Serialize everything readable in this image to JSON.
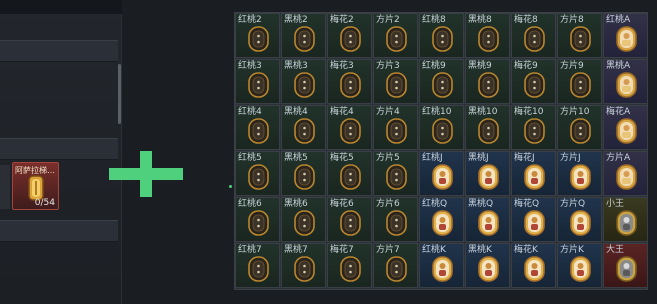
{
  "item": {
    "name": "阿萨拉梯…",
    "count": "0/54"
  },
  "columns": [
    "红桃",
    "黑桃",
    "梅花",
    "方片",
    "红桃",
    "黑桃",
    "梅花",
    "方片",
    "红桃"
  ],
  "grid": [
    [
      {
        "label": "红桃2",
        "kind": "num"
      },
      {
        "label": "黑桃2",
        "kind": "num"
      },
      {
        "label": "梅花2",
        "kind": "num"
      },
      {
        "label": "方片2",
        "kind": "num"
      },
      {
        "label": "红桃8",
        "kind": "num"
      },
      {
        "label": "黑桃8",
        "kind": "num"
      },
      {
        "label": "梅花8",
        "kind": "num"
      },
      {
        "label": "方片8",
        "kind": "num"
      },
      {
        "label": "红桃A",
        "kind": "ace"
      }
    ],
    [
      {
        "label": "红桃3",
        "kind": "num"
      },
      {
        "label": "黑桃3",
        "kind": "num"
      },
      {
        "label": "梅花3",
        "kind": "num"
      },
      {
        "label": "方片3",
        "kind": "num"
      },
      {
        "label": "红桃9",
        "kind": "num"
      },
      {
        "label": "黑桃9",
        "kind": "num"
      },
      {
        "label": "梅花9",
        "kind": "num"
      },
      {
        "label": "方片9",
        "kind": "num"
      },
      {
        "label": "黑桃A",
        "kind": "ace"
      }
    ],
    [
      {
        "label": "红桃4",
        "kind": "num"
      },
      {
        "label": "黑桃4",
        "kind": "num"
      },
      {
        "label": "梅花4",
        "kind": "num"
      },
      {
        "label": "方片4",
        "kind": "num"
      },
      {
        "label": "红桃10",
        "kind": "num"
      },
      {
        "label": "黑桃10",
        "kind": "num"
      },
      {
        "label": "梅花10",
        "kind": "num"
      },
      {
        "label": "方片10",
        "kind": "num"
      },
      {
        "label": "梅花A",
        "kind": "ace"
      }
    ],
    [
      {
        "label": "红桃5",
        "kind": "num"
      },
      {
        "label": "黑桃5",
        "kind": "num"
      },
      {
        "label": "梅花5",
        "kind": "num"
      },
      {
        "label": "方片5",
        "kind": "num"
      },
      {
        "label": "红桃J",
        "kind": "face"
      },
      {
        "label": "黑桃J",
        "kind": "face"
      },
      {
        "label": "梅花J",
        "kind": "face"
      },
      {
        "label": "方片J",
        "kind": "face"
      },
      {
        "label": "方片A",
        "kind": "ace"
      }
    ],
    [
      {
        "label": "红桃6",
        "kind": "num"
      },
      {
        "label": "黑桃6",
        "kind": "num"
      },
      {
        "label": "梅花6",
        "kind": "num"
      },
      {
        "label": "方片6",
        "kind": "num"
      },
      {
        "label": "红桃Q",
        "kind": "face"
      },
      {
        "label": "黑桃Q",
        "kind": "face"
      },
      {
        "label": "梅花Q",
        "kind": "face"
      },
      {
        "label": "方片Q",
        "kind": "face"
      },
      {
        "label": "小王",
        "kind": "joker-s"
      }
    ],
    [
      {
        "label": "红桃7",
        "kind": "num"
      },
      {
        "label": "黑桃7",
        "kind": "num"
      },
      {
        "label": "梅花7",
        "kind": "num"
      },
      {
        "label": "方片7",
        "kind": "num"
      },
      {
        "label": "红桃K",
        "kind": "face"
      },
      {
        "label": "黑桃K",
        "kind": "face"
      },
      {
        "label": "梅花K",
        "kind": "face"
      },
      {
        "label": "方片K",
        "kind": "face"
      },
      {
        "label": "大王",
        "kind": "joker-b"
      }
    ]
  ]
}
